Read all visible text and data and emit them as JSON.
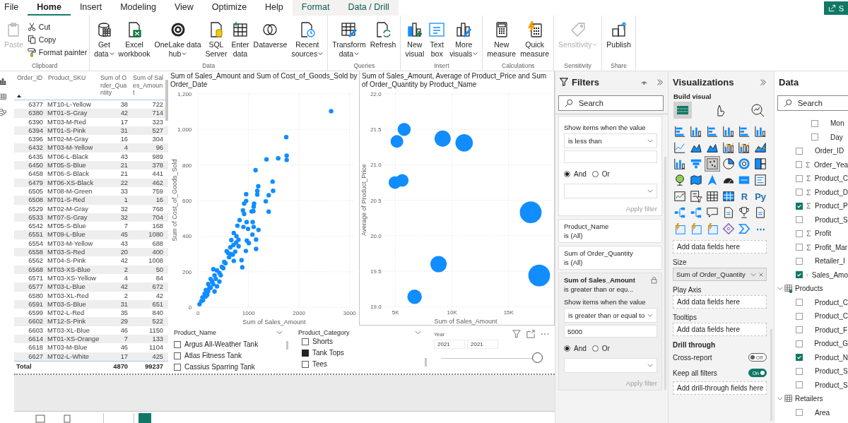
{
  "tabs": [
    {
      "label": "File",
      "selected": false,
      "kind": "plain"
    },
    {
      "label": "Home",
      "selected": true,
      "kind": "plain"
    },
    {
      "label": "Insert",
      "selected": false,
      "kind": "plain"
    },
    {
      "label": "Modeling",
      "selected": false,
      "kind": "plain"
    },
    {
      "label": "View",
      "selected": false,
      "kind": "plain"
    },
    {
      "label": "Optimize",
      "selected": false,
      "kind": "plain"
    },
    {
      "label": "Help",
      "selected": false,
      "kind": "plain"
    },
    {
      "label": "Format",
      "selected": false,
      "kind": "contextual"
    },
    {
      "label": "Data / Drill",
      "selected": false,
      "kind": "contextual"
    }
  ],
  "share_button": {
    "label": "S"
  },
  "ribbon": [
    {
      "label": "Clipboard",
      "buttons": [
        {
          "kind": "large",
          "lines": [
            "Paste"
          ],
          "dropdown": false,
          "disabled": true
        },
        {
          "kind": "small",
          "lines": [
            "Cut"
          ],
          "dropdown": false,
          "disabled": false
        },
        {
          "kind": "small",
          "lines": [
            "Copy"
          ],
          "dropdown": false,
          "disabled": false
        },
        {
          "kind": "small",
          "lines": [
            "Format painter"
          ],
          "dropdown": false,
          "disabled": false
        }
      ]
    },
    {
      "label": "Data",
      "buttons": [
        {
          "kind": "large",
          "lines": [
            "Get",
            "data"
          ],
          "dropdown": true,
          "disabled": false
        },
        {
          "kind": "large",
          "lines": [
            "Excel",
            "workbook"
          ],
          "dropdown": false,
          "disabled": false
        },
        {
          "kind": "large",
          "lines": [
            "OneLake data",
            "hub"
          ],
          "dropdown": true,
          "disabled": false
        },
        {
          "kind": "large",
          "lines": [
            "SQL",
            "Server"
          ],
          "dropdown": false,
          "disabled": false
        },
        {
          "kind": "large",
          "lines": [
            "Enter",
            "data"
          ],
          "dropdown": false,
          "disabled": false
        },
        {
          "kind": "large",
          "lines": [
            "Dataverse"
          ],
          "dropdown": false,
          "disabled": false
        },
        {
          "kind": "large",
          "lines": [
            "Recent",
            "sources"
          ],
          "dropdown": true,
          "disabled": false
        }
      ]
    },
    {
      "label": "Queries",
      "buttons": [
        {
          "kind": "large",
          "lines": [
            "Transform",
            "data"
          ],
          "dropdown": true,
          "disabled": false
        },
        {
          "kind": "large",
          "lines": [
            "Refresh"
          ],
          "dropdown": false,
          "disabled": false
        }
      ]
    },
    {
      "label": "Insert",
      "buttons": [
        {
          "kind": "large",
          "lines": [
            "New",
            "visual"
          ],
          "dropdown": false,
          "disabled": false
        },
        {
          "kind": "large",
          "lines": [
            "Text",
            "box"
          ],
          "dropdown": false,
          "disabled": false
        },
        {
          "kind": "large",
          "lines": [
            "More",
            "visuals"
          ],
          "dropdown": true,
          "disabled": false
        }
      ]
    },
    {
      "label": "Calculations",
      "buttons": [
        {
          "kind": "large",
          "lines": [
            "New",
            "measure"
          ],
          "dropdown": false,
          "disabled": false
        },
        {
          "kind": "large",
          "lines": [
            "Quick",
            "measure"
          ],
          "dropdown": false,
          "disabled": false
        }
      ]
    },
    {
      "label": "Sensitivity",
      "buttons": [
        {
          "kind": "large",
          "lines": [
            "Sensitivity"
          ],
          "dropdown": true,
          "disabled": true
        }
      ]
    },
    {
      "label": "Share",
      "buttons": [
        {
          "kind": "large",
          "lines": [
            "Publish"
          ],
          "dropdown": false,
          "disabled": false
        }
      ]
    }
  ],
  "table": {
    "columns": [
      "Order_ID",
      "Product_SKU",
      "Sum of Order_Quantity",
      "Sum of Sales_Amount"
    ],
    "rows": [
      [
        "6377",
        "MT10-L-Yellow",
        "38",
        "722"
      ],
      [
        "6380",
        "MT01-S-Gray",
        "42",
        "714"
      ],
      [
        "6390",
        "MT03-M-Red",
        "17",
        "323"
      ],
      [
        "6394",
        "MT01-S-Pink",
        "31",
        "527"
      ],
      [
        "6396",
        "MT02-M-Gray",
        "16",
        "304"
      ],
      [
        "6432",
        "MT03-M-Yellow",
        "4",
        "96"
      ],
      [
        "6435",
        "MT06-L-Black",
        "43",
        "989"
      ],
      [
        "6450",
        "MT05-S-Blue",
        "21",
        "378"
      ],
      [
        "6458",
        "MT06-S-Black",
        "21",
        "441"
      ],
      [
        "6479",
        "MT06-XS-Black",
        "22",
        "462"
      ],
      [
        "6505",
        "MT08-M-Green",
        "33",
        "759"
      ],
      [
        "6508",
        "MT01-S-Red",
        "1",
        "16"
      ],
      [
        "6529",
        "MT02-M-Gray",
        "32",
        "768"
      ],
      [
        "6533",
        "MT07-S-Gray",
        "32",
        "704"
      ],
      [
        "6542",
        "MT05-S-Blue",
        "7",
        "168"
      ],
      [
        "6551",
        "MT09-L-Blue",
        "45",
        "1080"
      ],
      [
        "6554",
        "MT03-M-Yellow",
        "43",
        "688"
      ],
      [
        "6558",
        "MT03-S-Red",
        "20",
        "400"
      ],
      [
        "6562",
        "MT04-S-Pink",
        "42",
        "1008"
      ],
      [
        "6568",
        "MT03-XS-Blue",
        "2",
        "50"
      ],
      [
        "6571",
        "MT03-XS-Yellow",
        "4",
        "84"
      ],
      [
        "6577",
        "MT03-L-Blue",
        "42",
        "672"
      ],
      [
        "6580",
        "MT03-XL-Red",
        "2",
        "42"
      ],
      [
        "6591",
        "MT03-S-Blue",
        "31",
        "651"
      ],
      [
        "6599",
        "MT02-L-Red",
        "35",
        "840"
      ],
      [
        "6602",
        "MT12-S-Pink",
        "29",
        "522"
      ],
      [
        "6603",
        "MT03-XL-Blue",
        "46",
        "1150"
      ],
      [
        "6614",
        "MT01-XS-Orange",
        "7",
        "133"
      ],
      [
        "6618",
        "MT03-M-Blue",
        "46",
        "1104"
      ],
      [
        "6627",
        "MT02-L-White",
        "17",
        "425"
      ]
    ],
    "total": {
      "label": "Total",
      "values": [
        "4870",
        "99237"
      ]
    }
  },
  "scatter": {
    "chart_data": {
      "type": "scatter",
      "title": "Sum of Sales_Amount and Sum of Cost_of_Goods_Sold by Order_Date",
      "xlabel": "Sum of Sales_Amount",
      "grid": true,
      "xlim": [
        0,
        3000
      ],
      "ylim": [
        0,
        1200
      ],
      "xticks": [
        0,
        1000,
        2000,
        3000
      ],
      "yticks": [
        0,
        200,
        400,
        600,
        800,
        {
          "value": 1000,
          "label": "1,000"
        },
        {
          "value": 1200,
          "label": "1,200"
        }
      ],
      "x": [
        2635,
        1746,
        1356,
        1587,
        1755,
        1755,
        1139,
        1192,
        1173,
        1173,
        1476,
        1486,
        1399,
        1341,
        1399,
        952,
        952,
        913,
        1110,
        1101,
        889,
        913,
        1062,
        1096,
        822,
        962,
        1082,
        779,
        899,
        990,
        1101,
        1197,
        1077,
        1149,
        967,
        1005,
        1149,
        947,
        861,
        875,
        707,
        659,
        755,
        803,
        639,
        567,
        688,
        615,
        707,
        543,
        471,
        375,
        423,
        303,
        327,
        250,
        279,
        202,
        226,
        154,
        130,
        87,
        63,
        29,
        327,
        183,
        519,
        591,
        735,
        423,
        375,
        760,
        800,
        700,
        650,
        500,
        450,
        350,
        300,
        250,
        200,
        150,
        100
      ],
      "series": [
        {
          "name": "Sum of Cost_of_Goods_Sold",
          "color": "#118dff",
          "values": [
            1103,
            957,
            832,
            838,
            853,
            829,
            771,
            681,
            655,
            634,
            707,
            655,
            630,
            596,
            538,
            636,
            598,
            583,
            583,
            566,
            545,
            525,
            539,
            541,
            490,
            479,
            479,
            459,
            452,
            441,
            452,
            435,
            409,
            381,
            375,
            361,
            328,
            317,
            265,
            225,
            418,
            378,
            364,
            343,
            337,
            316,
            296,
            282,
            261,
            248,
            227,
            207,
            193,
            214,
            180,
            159,
            145,
            131,
            111,
            97,
            75,
            55,
            34,
            17,
            89,
            70,
            255,
            306,
            313,
            145,
            118,
            400,
            380,
            350,
            300,
            220,
            180,
            160,
            130,
            110,
            90,
            60,
            40
          ]
        }
      ]
    }
  },
  "bubble": {
    "chart_data": {
      "type": "scatter",
      "title": "Sum of Sales_Amount, Average of Product_Price and Sum of Order_Quantity by Product_Name",
      "xlabel": "Sum of Sales_Amount",
      "grid": true,
      "xlim": [
        4000,
        18900
      ],
      "ylim": [
        19,
        22
      ],
      "xticks": [
        {
          "value": 5000,
          "label": "5K"
        },
        {
          "value": 10000,
          "label": "10K"
        },
        {
          "value": 15000,
          "label": "15K"
        }
      ],
      "yticks": [
        {
          "value": 19,
          "label": "19.0"
        },
        {
          "value": 19.5,
          "label": "19.5"
        },
        {
          "value": 20,
          "label": "20.0"
        },
        {
          "value": 20.5,
          "label": "20.5"
        },
        {
          "value": 21,
          "label": "21.0"
        },
        {
          "value": 21.5,
          "label": "21.5"
        },
        {
          "value": 22,
          "label": "22.0"
        }
      ],
      "x": [
        5770,
        5130,
        9170,
        11070,
        4960,
        5600,
        16950,
        8810,
        6690,
        17700
      ],
      "series": [
        {
          "name": "Average of Product_Price",
          "color": "#118dff",
          "values": [
            21.5,
            21.33,
            21.37,
            21.31,
            20.75,
            20.78,
            20.33,
            19.6,
            19.14,
            19.44
          ],
          "sizes": [
            0.36,
            0.34,
            0.55,
            0.64,
            0.34,
            0.34,
            1,
            0.56,
            0.44,
            1
          ]
        }
      ]
    }
  },
  "slicers": [
    {
      "kind": "list",
      "title": "Product_Name",
      "items": [
        {
          "label": "Argus All-Weather Tank",
          "checked": false
        },
        {
          "label": "Atlas Fitness Tank",
          "checked": false
        },
        {
          "label": "Cassius Sparring Tank",
          "checked": false
        }
      ]
    },
    {
      "kind": "list",
      "title": "Product_Category",
      "items": [
        {
          "label": "Shorts",
          "checked": false
        },
        {
          "label": "Tank Tops",
          "checked": true
        },
        {
          "label": "Tees",
          "checked": false
        }
      ]
    },
    {
      "kind": "range",
      "title": "Year",
      "from": "2021",
      "to": "2021",
      "level": 1
    }
  ],
  "filters": {
    "title": "Filters",
    "search_placeholder": "Search",
    "cards": [
      {
        "kind": "advanced",
        "prompt": "Show items when the value",
        "operator": "is less than",
        "radios": [
          {
            "label": "And",
            "selected": true
          },
          {
            "label": "Or",
            "selected": false
          }
        ],
        "apply": "Apply filter"
      },
      {
        "kind": "summary",
        "field": "Product_Name",
        "summary": "is (All)"
      },
      {
        "kind": "summary",
        "field": "Sum of Order_Quantity",
        "summary": "is (All)"
      },
      {
        "kind": "advanced",
        "field": "Sum of Sales_Amount",
        "summary": "is greater than or equ...",
        "locked": true,
        "prompt": "Show items when the value",
        "operator": "is greater than or equal to",
        "value": "5000",
        "radios": [
          {
            "label": "And",
            "selected": true
          },
          {
            "label": "Or",
            "selected": false
          }
        ],
        "apply": "Apply filter"
      }
    ]
  },
  "visualizations": {
    "title": "Visualizations",
    "subtitle": "Build visual",
    "modes": [
      {
        "selected": true
      },
      {
        "selected": false
      },
      {
        "selected": false
      }
    ],
    "gallery": [
      {
        "selected": false
      },
      {
        "selected": false
      },
      {
        "selected": false
      },
      {
        "selected": false
      },
      {
        "selected": false
      },
      {
        "selected": false
      },
      {
        "selected": false
      },
      {
        "selected": false
      },
      {
        "selected": false
      },
      {
        "selected": false
      },
      {
        "selected": false
      },
      {
        "selected": false
      },
      {
        "selected": false
      },
      {
        "selected": false
      },
      {
        "selected": true
      },
      {
        "selected": false
      },
      {
        "selected": false
      },
      {
        "selected": false
      },
      {
        "selected": false
      },
      {
        "selected": false
      },
      {
        "selected": false
      },
      {
        "selected": false
      },
      {
        "selected": false
      },
      {
        "selected": false
      },
      {
        "selected": false
      },
      {
        "selected": false
      },
      {
        "selected": false
      },
      {
        "selected": false
      },
      {
        "selected": false,
        "glyph": "R"
      },
      {
        "selected": false,
        "glyph": "Py"
      },
      {
        "selected": false
      },
      {
        "selected": false
      },
      {
        "selected": false
      },
      {
        "selected": false
      },
      {
        "selected": false
      },
      {
        "selected": false
      },
      {
        "selected": false
      },
      {
        "selected": false
      },
      {
        "selected": false
      },
      {
        "selected": false
      },
      {
        "selected": false
      },
      {
        "selected": false,
        "glyph": "⋯"
      }
    ],
    "wells": [
      {
        "hint": "Add data fields here"
      },
      {
        "title": "Size",
        "field": "Sum of Order_Quantity"
      },
      {
        "title": "Play Axis",
        "hint": "Add data fields here"
      },
      {
        "title": "Tooltips",
        "hint": "Add data fields here"
      }
    ],
    "drill_through": {
      "title": "Drill through",
      "toggles": [
        {
          "label": "Cross-report",
          "on": false,
          "state": "Off"
        },
        {
          "label": "Keep all filters",
          "on": true,
          "state": "On"
        }
      ],
      "hint": "Add drill-through fields here"
    }
  },
  "data": {
    "title": "Data",
    "search_placeholder": "Search",
    "tree": [
      {
        "kind": "level",
        "label": "Mon",
        "checked": false
      },
      {
        "kind": "level",
        "label": "Day",
        "checked": false
      },
      {
        "kind": "column",
        "label": "Order_ID",
        "checked": false
      },
      {
        "kind": "measure",
        "label": "Order_Yea",
        "checked": false
      },
      {
        "kind": "measure",
        "label": "Product_C",
        "checked": false
      },
      {
        "kind": "measure",
        "label": "Product_D",
        "checked": false
      },
      {
        "kind": "measure",
        "label": "Product_P",
        "checked": true
      },
      {
        "kind": "column",
        "label": "Product_S",
        "checked": false
      },
      {
        "kind": "measure",
        "label": "Profit",
        "checked": false
      },
      {
        "kind": "measure",
        "label": "Profit_Mar",
        "checked": false
      },
      {
        "kind": "column",
        "label": "Retailer_I",
        "checked": false
      },
      {
        "kind": "measure",
        "label": "Sales_Amo",
        "checked": true
      },
      {
        "kind": "table",
        "label": "Products",
        "expanded": true,
        "used": true,
        "children": [
          {
            "kind": "column",
            "label": "Product_C",
            "checked": false
          },
          {
            "kind": "column",
            "label": "Product_C",
            "checked": false
          },
          {
            "kind": "column",
            "label": "Product_F",
            "checked": false
          },
          {
            "kind": "column",
            "label": "Product_G",
            "checked": false
          },
          {
            "kind": "column",
            "label": "Product_N",
            "checked": true
          },
          {
            "kind": "column",
            "label": "Product_S",
            "checked": false
          },
          {
            "kind": "column",
            "label": "Product_S",
            "checked": false
          }
        ]
      },
      {
        "kind": "table",
        "label": "Retailers",
        "expanded": true,
        "used": false,
        "children": [
          {
            "kind": "column",
            "label": "Area",
            "checked": false
          }
        ]
      }
    ]
  }
}
